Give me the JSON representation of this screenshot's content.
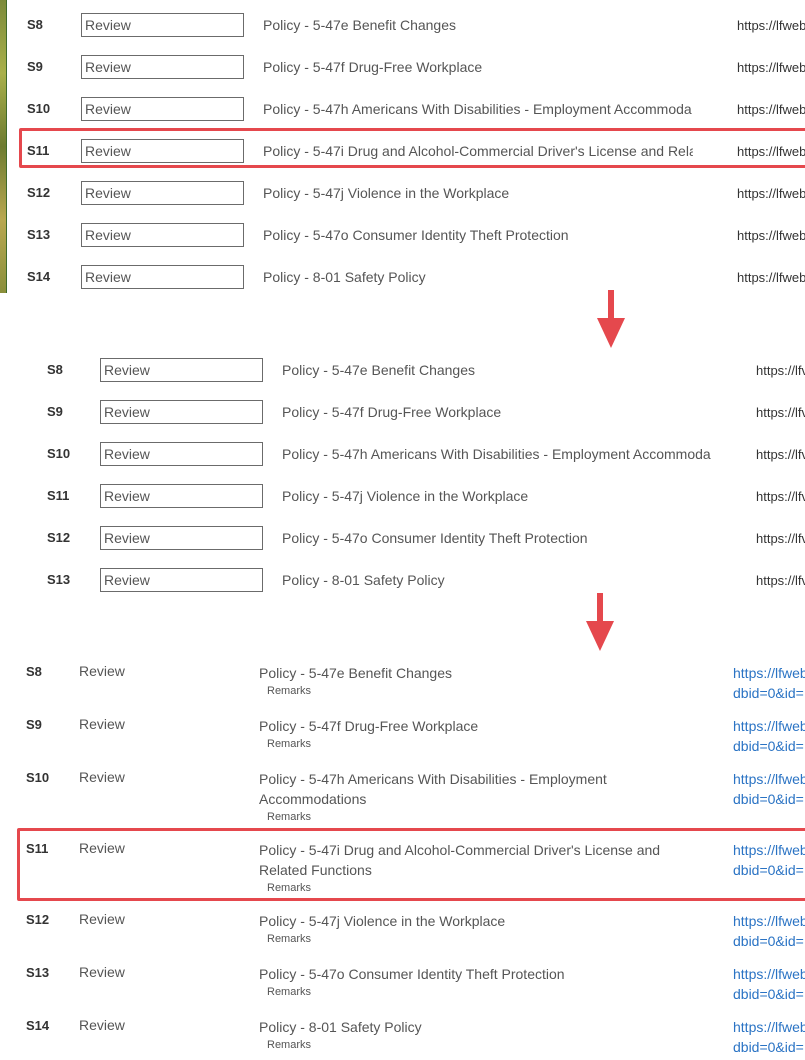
{
  "accent_color": "#e5484d",
  "link_color": "#2a73c4",
  "arrow_icon": "down-arrow-icon",
  "panel1": {
    "rows": [
      {
        "id": "S8",
        "review": "Review",
        "title": "Policy - 5-47e Benefit Changes",
        "url": "https://lfweb"
      },
      {
        "id": "S9",
        "review": "Review",
        "title": "Policy - 5-47f Drug-Free Workplace",
        "url": "https://lfweb"
      },
      {
        "id": "S10",
        "review": "Review",
        "title": "Policy - 5-47h Americans With Disabilities - Employment Accommoda",
        "url": "https://lfweb"
      },
      {
        "id": "S11",
        "review": "Review",
        "title": "Policy - 5-47i Drug and Alcohol-Commercial Driver's License and Rela",
        "url": "https://lfweb"
      },
      {
        "id": "S12",
        "review": "Review",
        "title": "Policy - 5-47j Violence in the Workplace",
        "url": "https://lfweb"
      },
      {
        "id": "S13",
        "review": "Review",
        "title": "Policy - 5-47o Consumer Identity Theft Protection",
        "url": "https://lfweb"
      },
      {
        "id": "S14",
        "review": "Review",
        "title": "Policy - 8-01 Safety Policy",
        "url": "https://lfweb"
      }
    ]
  },
  "panel2": {
    "rows": [
      {
        "id": "S8",
        "review": "Review",
        "title": "Policy - 5-47e Benefit Changes",
        "url": "https://lfv"
      },
      {
        "id": "S9",
        "review": "Review",
        "title": "Policy - 5-47f Drug-Free Workplace",
        "url": "https://lfv"
      },
      {
        "id": "S10",
        "review": "Review",
        "title": "Policy - 5-47h Americans With Disabilities - Employment Accommoda",
        "url": "https://lfv"
      },
      {
        "id": "S11",
        "review": "Review",
        "title": "Policy - 5-47j Violence in the Workplace",
        "url": "https://lfv"
      },
      {
        "id": "S12",
        "review": "Review",
        "title": "Policy - 5-47o Consumer Identity Theft Protection",
        "url": "https://lfv"
      },
      {
        "id": "S13",
        "review": "Review",
        "title": "Policy - 8-01 Safety Policy",
        "url": "https://lfv"
      }
    ]
  },
  "panel3": {
    "remarks_label": "Remarks",
    "rows": [
      {
        "id": "S8",
        "review": "Review",
        "title": "Policy - 5-47e Benefit Changes",
        "link1": "https://lfweb",
        "link2": "dbid=0&id=:"
      },
      {
        "id": "S9",
        "review": "Review",
        "title": "Policy - 5-47f Drug-Free Workplace",
        "link1": "https://lfweb",
        "link2": "dbid=0&id=:"
      },
      {
        "id": "S10",
        "review": "Review",
        "title": "Policy - 5-47h Americans With Disabilities - Employment Accommodations",
        "link1": "https://lfweb",
        "link2": "dbid=0&id=:"
      },
      {
        "id": "S11",
        "review": "Review",
        "title": "Policy - 5-47i Drug and Alcohol-Commercial Driver's License and Related Functions",
        "link1": "https://lfweb",
        "link2": "dbid=0&id=:"
      },
      {
        "id": "S12",
        "review": "Review",
        "title": "Policy - 5-47j Violence in the Workplace",
        "link1": "https://lfweb",
        "link2": "dbid=0&id=:"
      },
      {
        "id": "S13",
        "review": "Review",
        "title": "Policy - 5-47o Consumer Identity Theft Protection",
        "link1": "https://lfweb",
        "link2": "dbid=0&id=:"
      },
      {
        "id": "S14",
        "review": "Review",
        "title": "Policy - 8-01 Safety Policy",
        "link1": "https://lfweb",
        "link2": "dbid=0&id=:"
      }
    ]
  }
}
